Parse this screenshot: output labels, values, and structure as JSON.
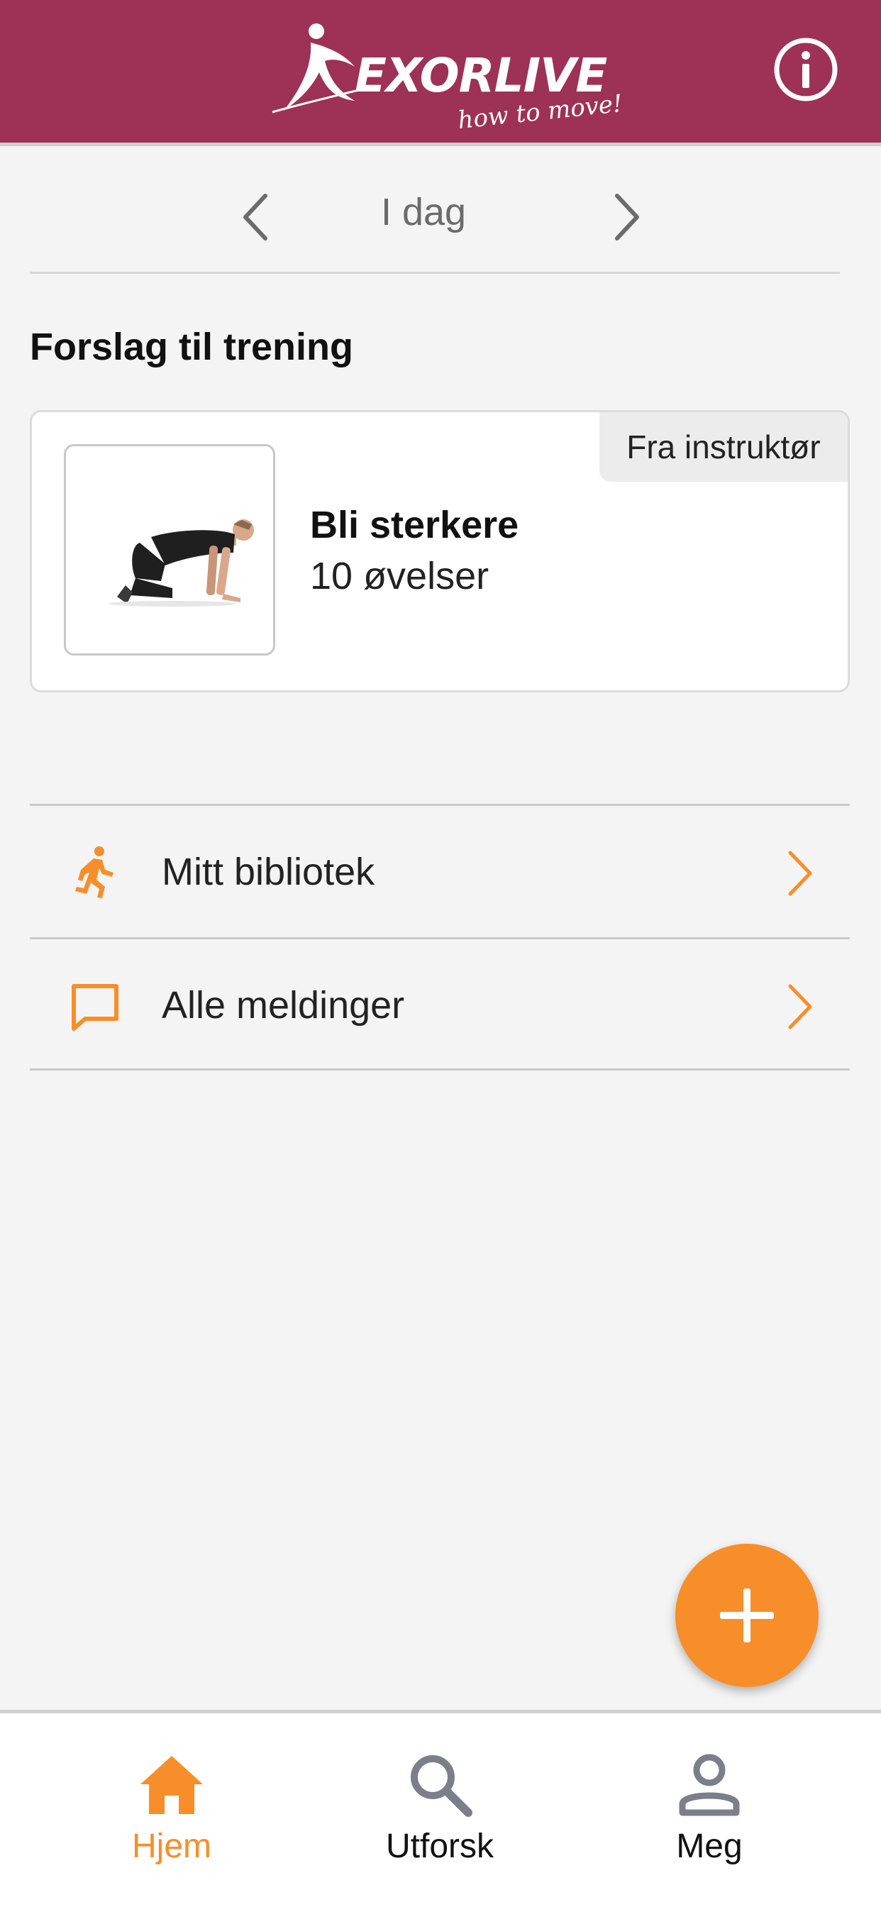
{
  "header": {
    "logo_text": "EXORLIVE",
    "logo_tagline": "how to move!",
    "info_icon": "info-icon"
  },
  "date_nav": {
    "label": "I dag",
    "prev_icon": "chevron-left-icon",
    "next_icon": "chevron-right-icon"
  },
  "suggestions": {
    "title": "Forslag til trening",
    "card": {
      "badge": "Fra instruktør",
      "title": "Bli sterkere",
      "subtitle": "10 øvelser"
    }
  },
  "links": [
    {
      "label": "Mitt bibliotek",
      "icon": "running-person-icon"
    },
    {
      "label": "Alle meldinger",
      "icon": "message-icon"
    }
  ],
  "fab": {
    "icon": "plus-icon"
  },
  "bottom_nav": {
    "items": [
      {
        "label": "Hjem",
        "icon": "home-icon",
        "active": true
      },
      {
        "label": "Utforsk",
        "icon": "search-icon",
        "active": false
      },
      {
        "label": "Meg",
        "icon": "person-icon",
        "active": false
      }
    ]
  },
  "colors": {
    "header_bg": "#9e3156",
    "accent": "#f78e2a",
    "background": "#f4f4f4",
    "nav_inactive_icon": "#7a7f8a"
  }
}
